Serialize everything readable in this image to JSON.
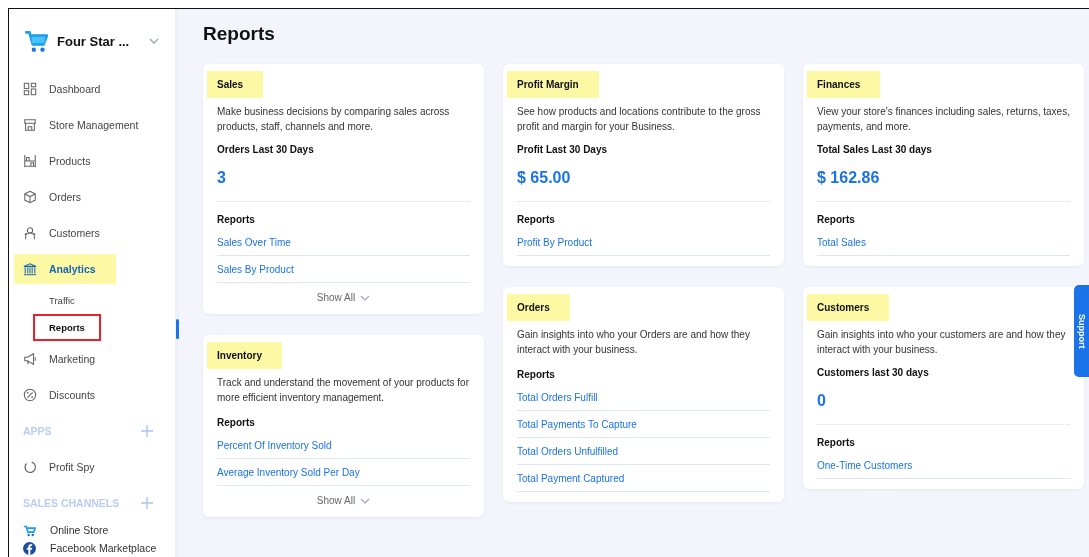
{
  "sidebar": {
    "brand": "Four Star ...",
    "items": [
      {
        "kind": "item",
        "label": "Dashboard",
        "highlighted": false,
        "outlined": false
      },
      {
        "kind": "item",
        "label": "Store Management",
        "highlighted": false,
        "outlined": false
      },
      {
        "kind": "item",
        "label": "Products",
        "highlighted": false,
        "outlined": false
      },
      {
        "kind": "item",
        "label": "Orders",
        "highlighted": false,
        "outlined": false
      },
      {
        "kind": "item",
        "label": "Customers",
        "highlighted": false,
        "outlined": false
      },
      {
        "kind": "item",
        "label": "Analytics",
        "highlighted": true,
        "outlined": false
      },
      {
        "kind": "subitem",
        "label": "Traffic",
        "highlighted": false,
        "outlined": false
      },
      {
        "kind": "subitem",
        "label": "Reports",
        "highlighted": false,
        "outlined": true
      },
      {
        "kind": "item",
        "label": "Marketing",
        "highlighted": false,
        "outlined": false
      },
      {
        "kind": "item",
        "label": "Discounts",
        "highlighted": false,
        "outlined": false
      },
      {
        "kind": "section",
        "label": "APPS"
      },
      {
        "kind": "item",
        "label": "Profit Spy",
        "highlighted": false,
        "outlined": false
      },
      {
        "kind": "section",
        "label": "SALES CHANNELS"
      },
      {
        "kind": "channel",
        "label": "Online Store"
      },
      {
        "kind": "channel",
        "label": "Facebook Marketplace"
      }
    ]
  },
  "page": {
    "title": "Reports"
  },
  "columns": [
    [
      {
        "title": "Sales",
        "highlighted": true,
        "description": "Make business decisions by comparing sales across products, staff, channels and more.",
        "metric_label": "Orders Last 30 Days",
        "metric_value": "3",
        "reports_label": "Reports",
        "reports": [
          "Sales Over Time",
          "Sales By Product"
        ],
        "show_all": "Show All"
      },
      {
        "title": "Inventory",
        "highlighted": true,
        "description": "Track and understand the movement of your products for more efficient inventory management.",
        "reports_label": "Reports",
        "reports": [
          "Percent Of Inventory Sold",
          "Average Inventory Sold Per Day"
        ],
        "show_all": "Show All"
      }
    ],
    [
      {
        "title": "Profit Margin",
        "highlighted": true,
        "description": "See how products and locations contribute to the gross profit and margin for your Business.",
        "metric_label": "Profit Last 30 Days",
        "metric_value": "$ 65.00",
        "reports_label": "Reports",
        "reports": [
          "Profit By Product"
        ]
      },
      {
        "title": "Orders",
        "highlighted": true,
        "description": "Gain insights into who your Orders are and how they interact with your business.",
        "reports_label": "Reports",
        "reports": [
          "Total Orders Fulfill",
          "Total Payments To Capture",
          "Total Orders Unfulfilled",
          "Total Payment Captured"
        ]
      }
    ],
    [
      {
        "title": "Finances",
        "highlighted": true,
        "description": "View your store's finances including sales, returns, taxes, payments, and more.",
        "metric_label": "Total Sales Last 30 days",
        "metric_value": "$ 162.86",
        "reports_label": "Reports",
        "reports": [
          "Total Sales"
        ]
      },
      {
        "title": "Customers",
        "highlighted": true,
        "description": "Gain insights into who your customers are and how they interact with your business.",
        "metric_label": "Customers last 30 days",
        "metric_value": "0",
        "reports_label": "Reports",
        "reports": [
          "One-Time Customers"
        ]
      }
    ]
  ],
  "support_tab": "Support"
}
